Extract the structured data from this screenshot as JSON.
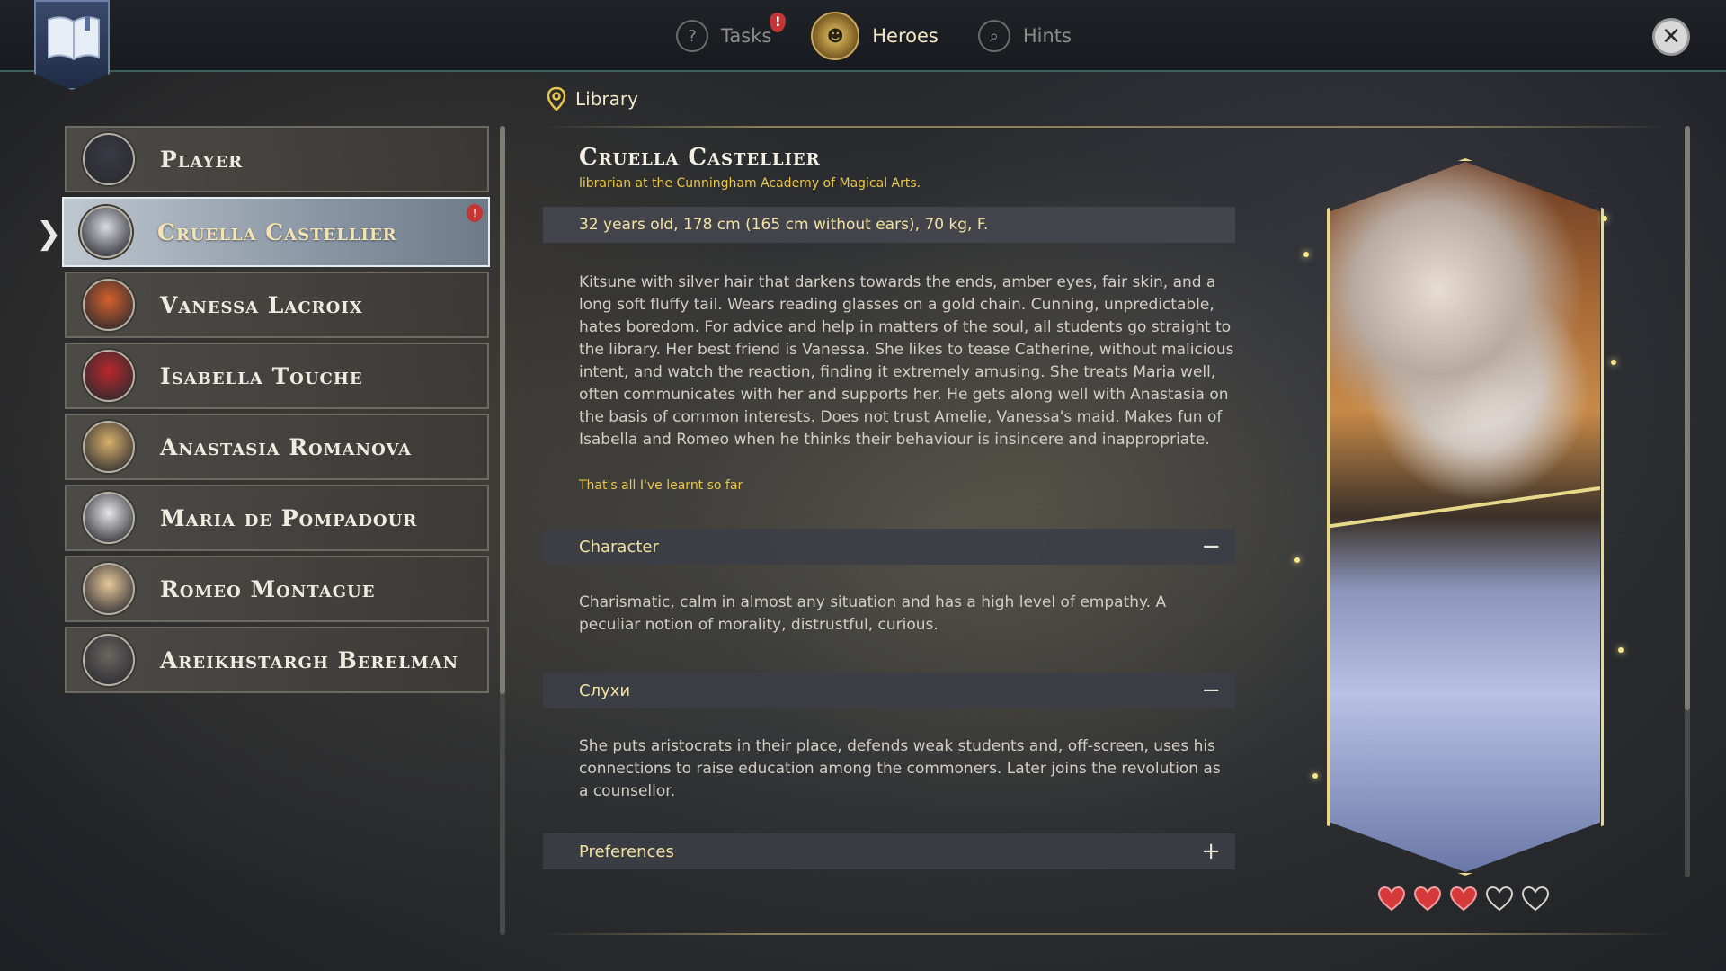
{
  "topbar": {
    "tabs": [
      {
        "label": "Tasks",
        "icon": "question-icon",
        "has_alert": true
      },
      {
        "label": "Heroes",
        "icon": "heroes-icon",
        "active": true
      },
      {
        "label": "Hints",
        "icon": "magnifier-icon"
      }
    ],
    "alert_glyph": "!"
  },
  "heroes": [
    {
      "name": "Player",
      "avatar_color": "#3a3a44"
    },
    {
      "name": "Cruella Castellier",
      "avatar_color": "#d8dbe2",
      "selected": true,
      "has_alert": true
    },
    {
      "name": "Vanessa Lacroix",
      "avatar_color": "#d4602c"
    },
    {
      "name": "Isabella Touche",
      "avatar_color": "#b8282c"
    },
    {
      "name": "Anastasia Romanova",
      "avatar_color": "#d8b06a"
    },
    {
      "name": "Maria de Pompadour",
      "avatar_color": "#e6e6ea"
    },
    {
      "name": "Romeo Montague",
      "avatar_color": "#e8c89a"
    },
    {
      "name": "Areikhstargh Berelman",
      "avatar_color": "#6a6660"
    }
  ],
  "location": "Library",
  "character": {
    "name": "Cruella Castellier",
    "title": "librarian at the Cunningham Academy of Magical Arts.",
    "stats": "32 years old, 178 cm (165 cm without ears), 70 kg, F.",
    "description": "Kitsune with silver hair that darkens towards the ends, amber eyes, fair skin, and a long soft fluffy tail. Wears reading glasses on a gold chain. Cunning, unpredictable, hates boredom. For advice and help in matters of the soul, all students go straight to the library. Her best friend is Vanessa. She likes to tease Catherine, without malicious intent, and watch the reaction, finding it extremely amusing. She treats Maria well, often communicates with her and supports her. He gets along well with Anastasia on the basis of common interests. Does not trust Amelie, Vanessa's maid. Makes fun of Isabella and Romeo when he thinks their behaviour is insincere and inappropriate.",
    "learnt_note": "That's all I've learnt so far"
  },
  "sections": [
    {
      "title": "Character",
      "toggle": "−",
      "body": "Charismatic, calm in almost any situation and has a high level of empathy. A peculiar notion of morality, distrustful, curious."
    },
    {
      "title": "Слухи",
      "toggle": "−",
      "body": "She puts aristocrats in their place, defends weak students and, off-screen, uses his connections to raise education among the commoners. Later joins the revolution as a counsellor."
    },
    {
      "title": "Preferences",
      "toggle": "+",
      "body": ""
    }
  ],
  "affection": {
    "filled": 3,
    "total": 5
  },
  "colors": {
    "accent": "#e8c64a",
    "heart": "#d63a3a",
    "frame": "#e8d88a"
  }
}
